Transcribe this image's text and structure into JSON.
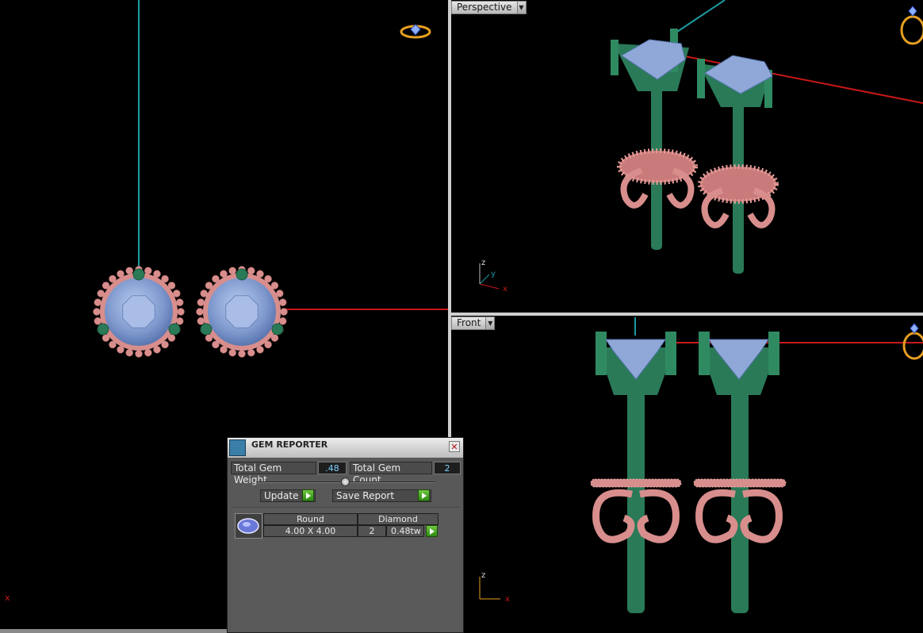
{
  "viewports": {
    "perspective": {
      "label": "Perspective"
    },
    "front": {
      "label": "Front"
    },
    "top_axis": {
      "x": "x"
    },
    "persp_axis": {
      "z": "z",
      "y": "y",
      "x": "x"
    },
    "front_axis": {
      "z": "z",
      "x": "x"
    }
  },
  "gem_reporter": {
    "title": "GEM REPORTER",
    "close_symbol": "✕",
    "total_weight_label": "Total Gem Weight",
    "total_weight_value": ".48",
    "total_count_label": "Total Gem Count",
    "total_count_value": "2",
    "update_label": "Update",
    "save_report_label": "Save Report",
    "gems": [
      {
        "shape": "Round",
        "size": "4.00 X 4.00",
        "type": "Diamond",
        "count": "2",
        "weight": "0.48tw"
      }
    ]
  },
  "colors": {
    "gem": "#8fa8d8",
    "prong": "#2a7a58",
    "rose_gold": "#d88e8c",
    "axis_red": "#c81818",
    "axis_cyan": "#1a9aa0"
  }
}
